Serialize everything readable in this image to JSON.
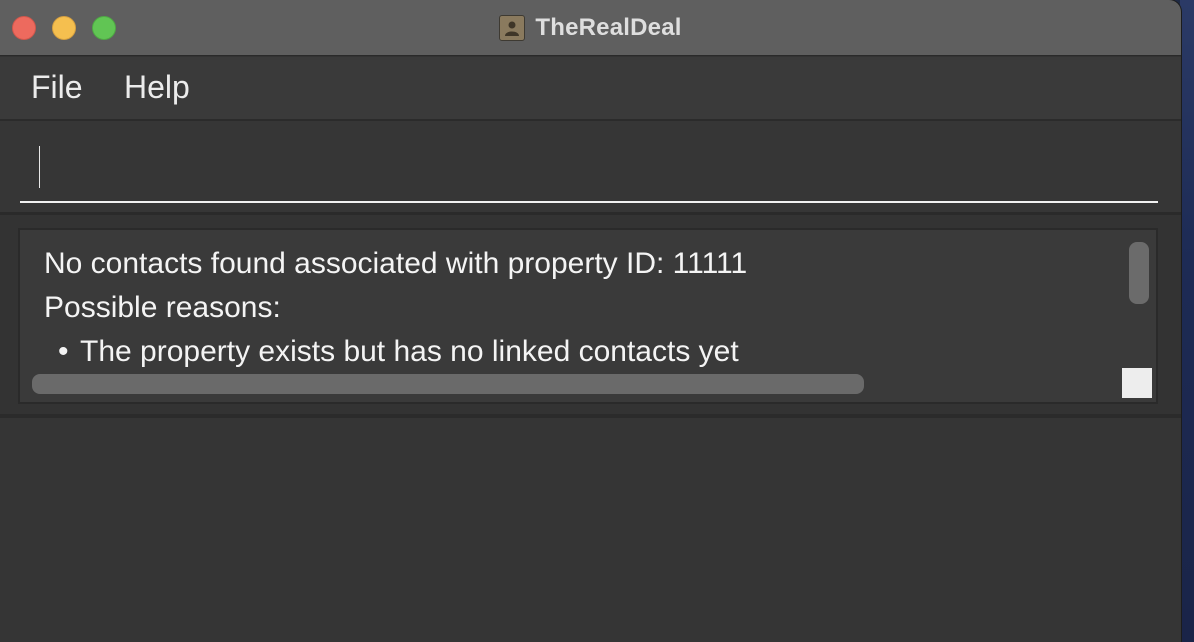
{
  "window": {
    "title": "TheRealDeal",
    "app_icon": "address-book-icon"
  },
  "menu": {
    "items": [
      {
        "label": "File"
      },
      {
        "label": "Help"
      }
    ]
  },
  "command": {
    "value": "",
    "placeholder": ""
  },
  "result": {
    "line1": "No contacts found associated with property ID: 11111",
    "line2": "Possible reasons:",
    "bullet_symbol": "•",
    "bullet1": "The property exists but has no linked contacts yet"
  },
  "colors": {
    "close": "#ed6a5e",
    "minimize": "#f5bf4f",
    "zoom": "#61c554",
    "background": "#333333"
  }
}
